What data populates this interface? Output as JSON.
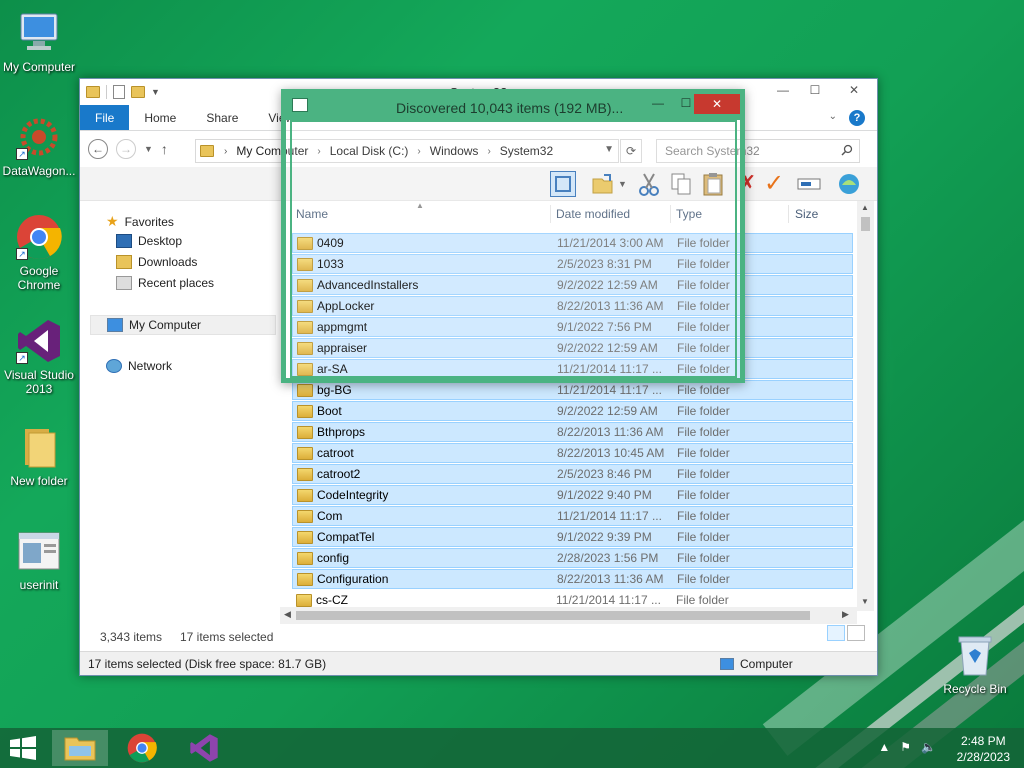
{
  "desktop": {
    "icons": [
      {
        "label": "My Computer"
      },
      {
        "label": "DataWagon..."
      },
      {
        "label": "Google Chrome"
      },
      {
        "label": "Visual Studio 2013"
      },
      {
        "label": "New folder"
      },
      {
        "label": "userinit"
      },
      {
        "label": "Recycle Bin"
      }
    ]
  },
  "explorer": {
    "title": "System32",
    "tabs": [
      "File",
      "Home",
      "Share",
      "View"
    ],
    "address": [
      "My Computer",
      "Local Disk (C:)",
      "Windows",
      "System32"
    ],
    "search_placeholder": "Search System32",
    "navpane": {
      "favorites": "Favorites",
      "desktop": "Desktop",
      "downloads": "Downloads",
      "recent": "Recent places",
      "computer": "My Computer",
      "network": "Network"
    },
    "columns": {
      "name": "Name",
      "date": "Date modified",
      "type": "Type",
      "size": "Size"
    },
    "rows": [
      {
        "name": "0409",
        "date": "11/21/2014 3:00 AM",
        "type": "File folder",
        "selected": true
      },
      {
        "name": "1033",
        "date": "2/5/2023 8:31 PM",
        "type": "File folder",
        "selected": true
      },
      {
        "name": "AdvancedInstallers",
        "date": "9/2/2022 12:59 AM",
        "type": "File folder",
        "selected": true
      },
      {
        "name": "AppLocker",
        "date": "8/22/2013 11:36 AM",
        "type": "File folder",
        "selected": true
      },
      {
        "name": "appmgmt",
        "date": "9/1/2022 7:56 PM",
        "type": "File folder",
        "selected": true
      },
      {
        "name": "appraiser",
        "date": "9/2/2022 12:59 AM",
        "type": "File folder",
        "selected": true
      },
      {
        "name": "ar-SA",
        "date": "11/21/2014 11:17 ...",
        "type": "File folder",
        "selected": true
      },
      {
        "name": "bg-BG",
        "date": "11/21/2014 11:17 ...",
        "type": "File folder",
        "selected": true
      },
      {
        "name": "Boot",
        "date": "9/2/2022 12:59 AM",
        "type": "File folder",
        "selected": true
      },
      {
        "name": "Bthprops",
        "date": "8/22/2013 11:36 AM",
        "type": "File folder",
        "selected": true
      },
      {
        "name": "catroot",
        "date": "8/22/2013 10:45 AM",
        "type": "File folder",
        "selected": true
      },
      {
        "name": "catroot2",
        "date": "2/5/2023 8:46 PM",
        "type": "File folder",
        "selected": true
      },
      {
        "name": "CodeIntegrity",
        "date": "9/1/2022 9:40 PM",
        "type": "File folder",
        "selected": true
      },
      {
        "name": "Com",
        "date": "11/21/2014 11:17 ...",
        "type": "File folder",
        "selected": true
      },
      {
        "name": "CompatTel",
        "date": "9/1/2022 9:39 PM",
        "type": "File folder",
        "selected": true
      },
      {
        "name": "config",
        "date": "2/28/2023 1:56 PM",
        "type": "File folder",
        "selected": true
      },
      {
        "name": "Configuration",
        "date": "8/22/2013 11:36 AM",
        "type": "File folder",
        "selected": true
      },
      {
        "name": "cs-CZ",
        "date": "11/21/2014 11:17 ...",
        "type": "File folder",
        "selected": false
      }
    ],
    "status_items": "3,343 items",
    "status_selected": "17 items selected",
    "statusbar_text": "17 items selected (Disk free space: 81.7 GB)",
    "statusbar_location": "Computer"
  },
  "dialog": {
    "title": "Discovered 10,043 items (192 MB)..."
  },
  "taskbar": {
    "time": "2:48 PM",
    "date": "2/28/2023"
  }
}
